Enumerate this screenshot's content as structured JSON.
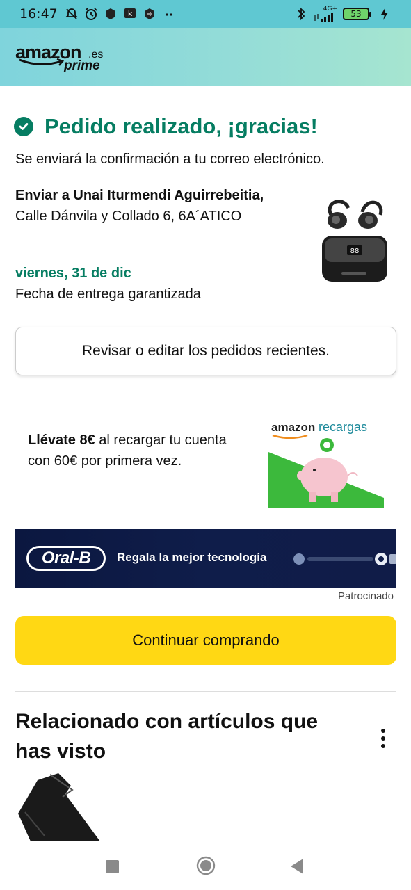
{
  "status_bar": {
    "time": "16:47",
    "network_label": "4G+",
    "battery": "53",
    "icons": [
      "bell-off-icon",
      "alarm-icon",
      "shield-icon",
      "k-app-icon",
      "sound-icon",
      "more-dots-icon",
      "bluetooth-icon",
      "signal-icon",
      "battery-icon",
      "charging-icon"
    ]
  },
  "header": {
    "logo_word": "amazon",
    "logo_domain": ".es",
    "logo_prime": "prime"
  },
  "confirmation": {
    "title": "Pedido realizado, ¡gracias!",
    "subtitle": "Se enviará la confirmación a tu correo electrónico."
  },
  "shipping": {
    "prefix": "Enviar a Unai Iturmendi Aguirrebeitia,",
    "address": " Calle Dánvila y Collado 6, 6A´ATICO",
    "delivery_date": "viernes, 31 de dic",
    "delivery_note": "Fecha de entrega garantizada"
  },
  "actions": {
    "review_orders": "Revisar o editar los pedidos recientes.",
    "continue_shopping": "Continuar comprando"
  },
  "promo": {
    "bold": "Llévate 8€",
    "rest": " al recargar tu cuenta con 60€ por primera vez.",
    "art_brand": "amazon",
    "art_product": "recargas"
  },
  "banner": {
    "brand": "Oral-B",
    "text": "Regala la mejor tecnología",
    "sponsored": "Patrocinado"
  },
  "related": {
    "title": "Relacionado con artículos que has visto"
  },
  "colors": {
    "accent_green": "#067d62",
    "header_teal": "#7fd4dc",
    "button_yellow": "#ffd814",
    "banner_navy": "#0f1d4a"
  }
}
